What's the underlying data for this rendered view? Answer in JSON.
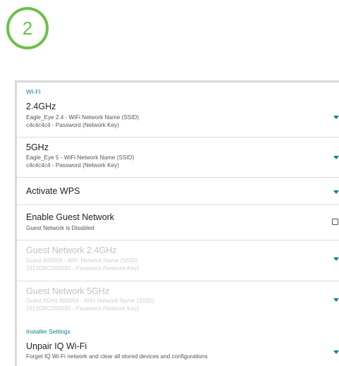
{
  "step": {
    "number": "2",
    "color": "#6cc04a"
  },
  "accent_color": "#00838f",
  "wifi_section": {
    "header": "WI-FI",
    "rows": [
      {
        "title": "2.4GHz",
        "lines": [
          "Eagle_Eye 2.4 - WiFi Network Name (SSID)",
          "c4c4c4c4 - Password (Network Key)"
        ],
        "control": "chevron-down-icon",
        "enabled": true
      },
      {
        "title": "5GHz",
        "lines": [
          "Eagle_Eye 5 - WiFi Network Name (SSID)",
          "c4c4c4c4 - Password (Network Key)"
        ],
        "control": "chevron-down-icon",
        "enabled": true
      },
      {
        "title": "Activate WPS",
        "lines": [],
        "control": "chevron-down-icon",
        "enabled": true
      },
      {
        "title": "Enable Guest Network",
        "lines": [
          "Guest Network is Disabled"
        ],
        "control": "checkbox",
        "checked": false,
        "enabled": true
      },
      {
        "title": "Guest Network 2.4GHz",
        "lines": [
          "Guest 800059 - WiFi Network Name (SSID)",
          "1912DBC000030 - Password (Network Key)"
        ],
        "control": "chevron-down-icon",
        "enabled": false
      },
      {
        "title": "Guest Network 5GHz",
        "lines": [
          "Guest 5GHz 800059 - WiFi Network Name (SSID)",
          "1912DBC000030 - Password (Network Key)"
        ],
        "control": "chevron-down-icon",
        "enabled": false
      }
    ]
  },
  "installer_section": {
    "header": "Installer Settings",
    "rows": [
      {
        "title": "Unpair IQ Wi-Fi",
        "lines": [
          "Forget IQ Wi-Fi network and clear all stored devices and configurations"
        ],
        "control": "chevron-down-icon",
        "enabled": true
      }
    ]
  }
}
